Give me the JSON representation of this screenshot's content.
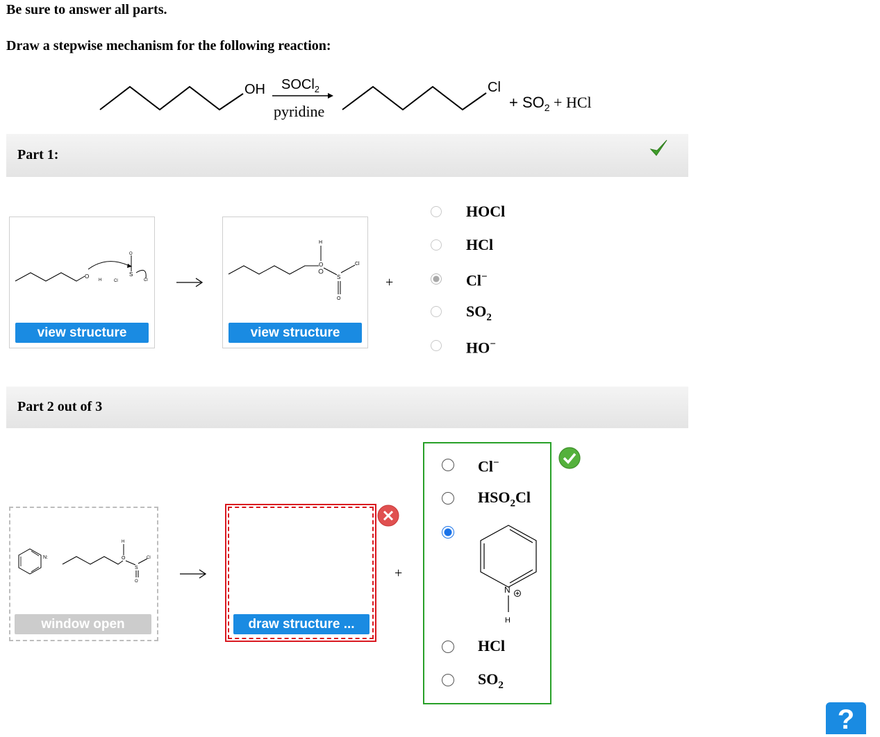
{
  "instructions": {
    "line1": "Be sure to answer all parts.",
    "line2": "Draw a stepwise mechanism for the following reaction:"
  },
  "reaction": {
    "reactant_group": "OH",
    "reagent_top": "SOCl",
    "reagent_top_sub": "2",
    "reagent_bottom": "pyridine",
    "product_group": "Cl",
    "byproducts": "+ SO",
    "byproducts_sub": "2",
    "byproducts_end": " + HCl"
  },
  "part1": {
    "title": "Part 1:",
    "status": "correct",
    "left_button": "view structure",
    "right_button": "view structure",
    "plus": "+",
    "options": [
      {
        "label": "HOCl",
        "sup": "",
        "sub": "",
        "selected": false
      },
      {
        "label": "HCl",
        "sup": "",
        "sub": "",
        "selected": false
      },
      {
        "label": "Cl",
        "sup": "−",
        "sub": "",
        "selected": true
      },
      {
        "label": "SO",
        "sup": "",
        "sub": "2",
        "selected": false
      },
      {
        "label": "HO",
        "sup": "−",
        "sub": "",
        "selected": false
      }
    ]
  },
  "part2": {
    "title": "Part 2 out of 3",
    "left_button": "window open",
    "right_button": "draw structure ...",
    "plus": "+",
    "options": [
      {
        "label": "Cl",
        "sup": "−",
        "sub": "",
        "selected": false
      },
      {
        "label": "HSO",
        "sub": "2",
        "label_end": "Cl",
        "selected": false
      },
      {
        "label": "pyridinium",
        "selected": true
      },
      {
        "label": "HCl",
        "sup": "",
        "sub": "",
        "selected": false
      },
      {
        "label": "SO",
        "sup": "",
        "sub": "2",
        "selected": false
      }
    ],
    "pyridinium_atoms": {
      "n": "N",
      "h": "H"
    }
  },
  "help_label": "?"
}
